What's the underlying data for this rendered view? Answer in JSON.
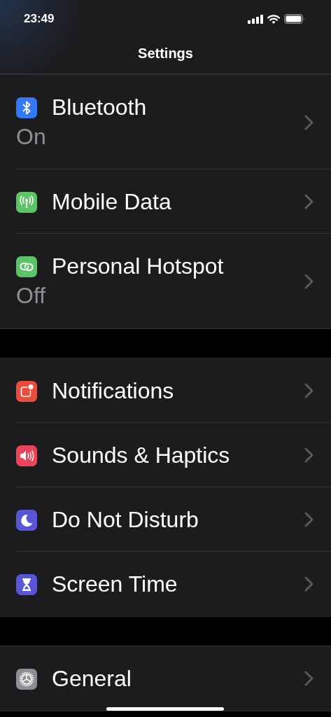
{
  "status_bar": {
    "time": "23:49"
  },
  "nav_bar": {
    "title": "Settings"
  },
  "sections": [
    {
      "rows": [
        {
          "kind": "bluetooth",
          "color": "#3478f6",
          "label": "Bluetooth",
          "detail": "On"
        },
        {
          "kind": "antenna",
          "color": "#5ac466",
          "label": "Mobile Data"
        },
        {
          "kind": "link",
          "color": "#5ac466",
          "label": "Personal Hotspot",
          "detail": "Off"
        }
      ]
    },
    {
      "rows": [
        {
          "kind": "notification",
          "color": "#eb4d3d",
          "label": "Notifications"
        },
        {
          "kind": "speaker",
          "color": "#eb445a",
          "label": "Sounds & Haptics"
        },
        {
          "kind": "moon",
          "color": "#5856d6",
          "label": "Do Not Disturb"
        },
        {
          "kind": "hourglass",
          "color": "#5856d6",
          "label": "Screen Time"
        }
      ]
    },
    {
      "rows": [
        {
          "kind": "gear",
          "color": "#8e8e93",
          "label": "General"
        }
      ]
    }
  ]
}
